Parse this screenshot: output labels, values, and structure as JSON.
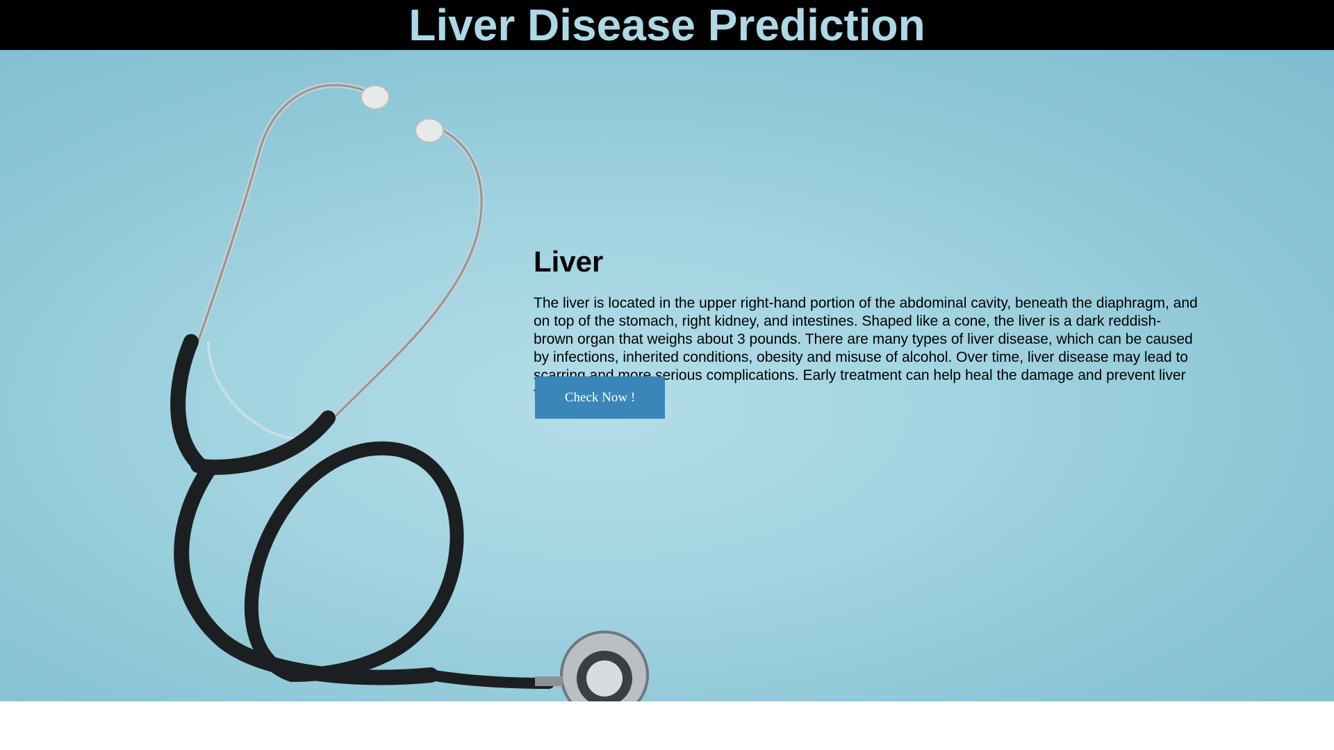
{
  "header": {
    "title": "Liver Disease Prediction"
  },
  "hero": {
    "heading": "Liver",
    "description": "The liver is located in the upper right-hand portion of the abdominal cavity, beneath the diaphragm, and on top of the stomach, right kidney, and intestines. Shaped like a cone, the liver is a dark reddish-brown organ that weighs about 3 pounds. There are many types of liver disease, which can be caused by infections, inherited conditions, obesity and misuse of alcohol. Over time, liver disease may lead to scarring and more serious complications. Early treatment can help heal the damage and prevent liver failure.",
    "button_label": "Check Now !"
  },
  "colors": {
    "title_color": "#add8e6",
    "header_bg": "#000000",
    "button_bg": "#3a86b8"
  },
  "images": {
    "background": "stethoscope-photo"
  }
}
